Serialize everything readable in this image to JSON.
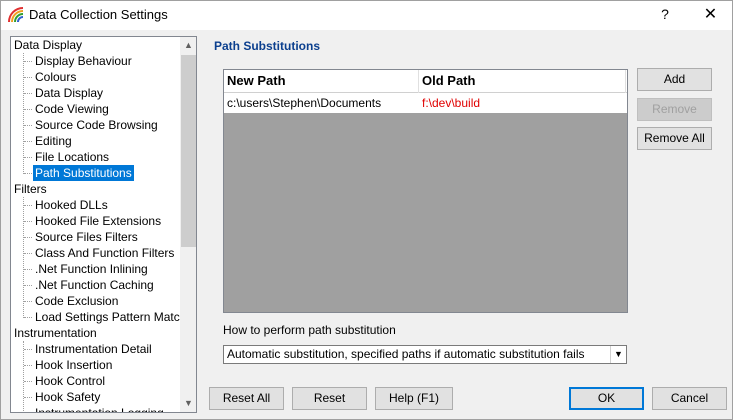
{
  "window": {
    "title": "Data Collection Settings",
    "help_glyph": "?",
    "close_glyph": "✕"
  },
  "sidebar": {
    "items": [
      {
        "label": "Data Display",
        "level": 0
      },
      {
        "label": "Display Behaviour",
        "level": 1
      },
      {
        "label": "Colours",
        "level": 1
      },
      {
        "label": "Data Display",
        "level": 1
      },
      {
        "label": "Code Viewing",
        "level": 1
      },
      {
        "label": "Source Code Browsing",
        "level": 1
      },
      {
        "label": "Editing",
        "level": 1
      },
      {
        "label": "File Locations",
        "level": 1
      },
      {
        "label": "Path Substitutions",
        "level": 1,
        "selected": true
      },
      {
        "label": "Filters",
        "level": 0
      },
      {
        "label": "Hooked DLLs",
        "level": 1
      },
      {
        "label": "Hooked File Extensions",
        "level": 1
      },
      {
        "label": "Source Files Filters",
        "level": 1
      },
      {
        "label": "Class And Function Filters",
        "level": 1
      },
      {
        "label": ".Net Function Inlining",
        "level": 1
      },
      {
        "label": ".Net Function Caching",
        "level": 1
      },
      {
        "label": "Code Exclusion",
        "level": 1
      },
      {
        "label": "Load Settings Pattern Match",
        "level": 1
      },
      {
        "label": "Instrumentation",
        "level": 0
      },
      {
        "label": "Instrumentation Detail",
        "level": 1
      },
      {
        "label": "Hook Insertion",
        "level": 1
      },
      {
        "label": "Hook Control",
        "level": 1
      },
      {
        "label": "Hook Safety",
        "level": 1
      },
      {
        "label": "Instrumentation Logging",
        "level": 1
      }
    ],
    "scroll_up_glyph": "▲",
    "scroll_down_glyph": "▼"
  },
  "main": {
    "section_title": "Path Substitutions",
    "table": {
      "columns": [
        "New Path",
        "Old Path"
      ],
      "rows": [
        {
          "new_path": "c:\\users\\Stephen\\Documents",
          "old_path": "f:\\dev\\build"
        }
      ]
    },
    "buttons": {
      "add": "Add",
      "remove": "Remove",
      "remove_all": "Remove All"
    },
    "how_label": "How to perform path substitution",
    "combo": {
      "value": "Automatic substitution, specified paths if automatic substitution fails",
      "arrow_glyph": "▼"
    }
  },
  "footer": {
    "reset_all": "Reset All",
    "reset": "Reset",
    "help": "Help (F1)",
    "ok": "OK",
    "cancel": "Cancel"
  },
  "colors": {
    "selection": "#0078d7",
    "section_title": "#0b3f8e",
    "old_path_text": "#e00000",
    "table_background": "#a0a0a0"
  }
}
